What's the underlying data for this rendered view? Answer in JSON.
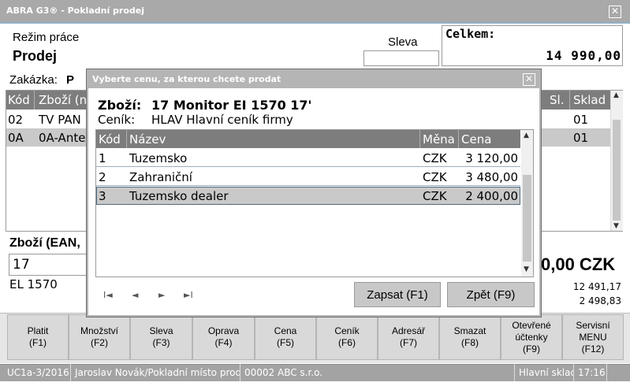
{
  "window": {
    "title": "ABRA G3® - Pokladní prodej",
    "close": "✕"
  },
  "header": {
    "mode_label": "Režim práce",
    "mode_value": "Prodej",
    "discount_label": "Sleva",
    "total_label": "Celkem:",
    "total_value": "14 990,00",
    "order_label": "Zakázka:",
    "order_value": "P"
  },
  "background_table": {
    "columns": [
      "Kód",
      "Zboží (n",
      "Sl.",
      "Sklad"
    ],
    "rows": [
      [
        "02",
        "TV PAN",
        "",
        "01"
      ],
      [
        "0A",
        "0A-Ante",
        "",
        "01"
      ]
    ]
  },
  "goods": {
    "label": "Zboží (EAN,",
    "input_value": "17",
    "name": "EL 1570",
    "price_partial": "0,00 CZK",
    "sum_1": "12 491,17",
    "sum_2": "2 498,83"
  },
  "function_keys": [
    {
      "label": "Platit\n(F1)"
    },
    {
      "label": "Množství\n(F2)"
    },
    {
      "label": "Sleva\n(F3)"
    },
    {
      "label": "Oprava\n(F4)"
    },
    {
      "label": "Cena\n(F5)"
    },
    {
      "label": "Ceník\n(F6)"
    },
    {
      "label": "Adresář\n(F7)"
    },
    {
      "label": "Smazat\n(F8)"
    },
    {
      "label": "Otevřené\núčtenky\n(F9)"
    },
    {
      "label": "Servisní\nMENU\n(F12)"
    }
  ],
  "status_bar": {
    "version": "UC1a-3/2016",
    "user": "Jaroslav Novák/Pokladní místo prod.",
    "company": "00002 ABC s.r.o.",
    "warehouse": "Hlavní sklad",
    "time": "17:16"
  },
  "modal": {
    "title": "Vyberte cenu, za kterou chcete prodat",
    "close": "✕",
    "goods_label": "Zboží:",
    "goods_value": "17 Monitor EI 1570 17'",
    "pricelist_label": "Ceník:",
    "pricelist_value": "HLAV Hlavní ceník firmy",
    "columns": [
      "Kód",
      "Název",
      "Měna",
      "Cena"
    ],
    "rows": [
      {
        "code": "1",
        "name": "Tuzemsko",
        "currency": "CZK",
        "price": "3 120,00"
      },
      {
        "code": "2",
        "name": "Zahraniční",
        "currency": "CZK",
        "price": "3 480,00"
      },
      {
        "code": "3",
        "name": "Tuzemsko dealer",
        "currency": "CZK",
        "price": "2 400,00"
      }
    ],
    "selected_row": 3,
    "nav": {
      "first": "I◄",
      "prev": "◄",
      "next": "►",
      "last": "►I"
    },
    "confirm_button": "Zapsat (F1)",
    "back_button": "Zpět (F9)"
  }
}
